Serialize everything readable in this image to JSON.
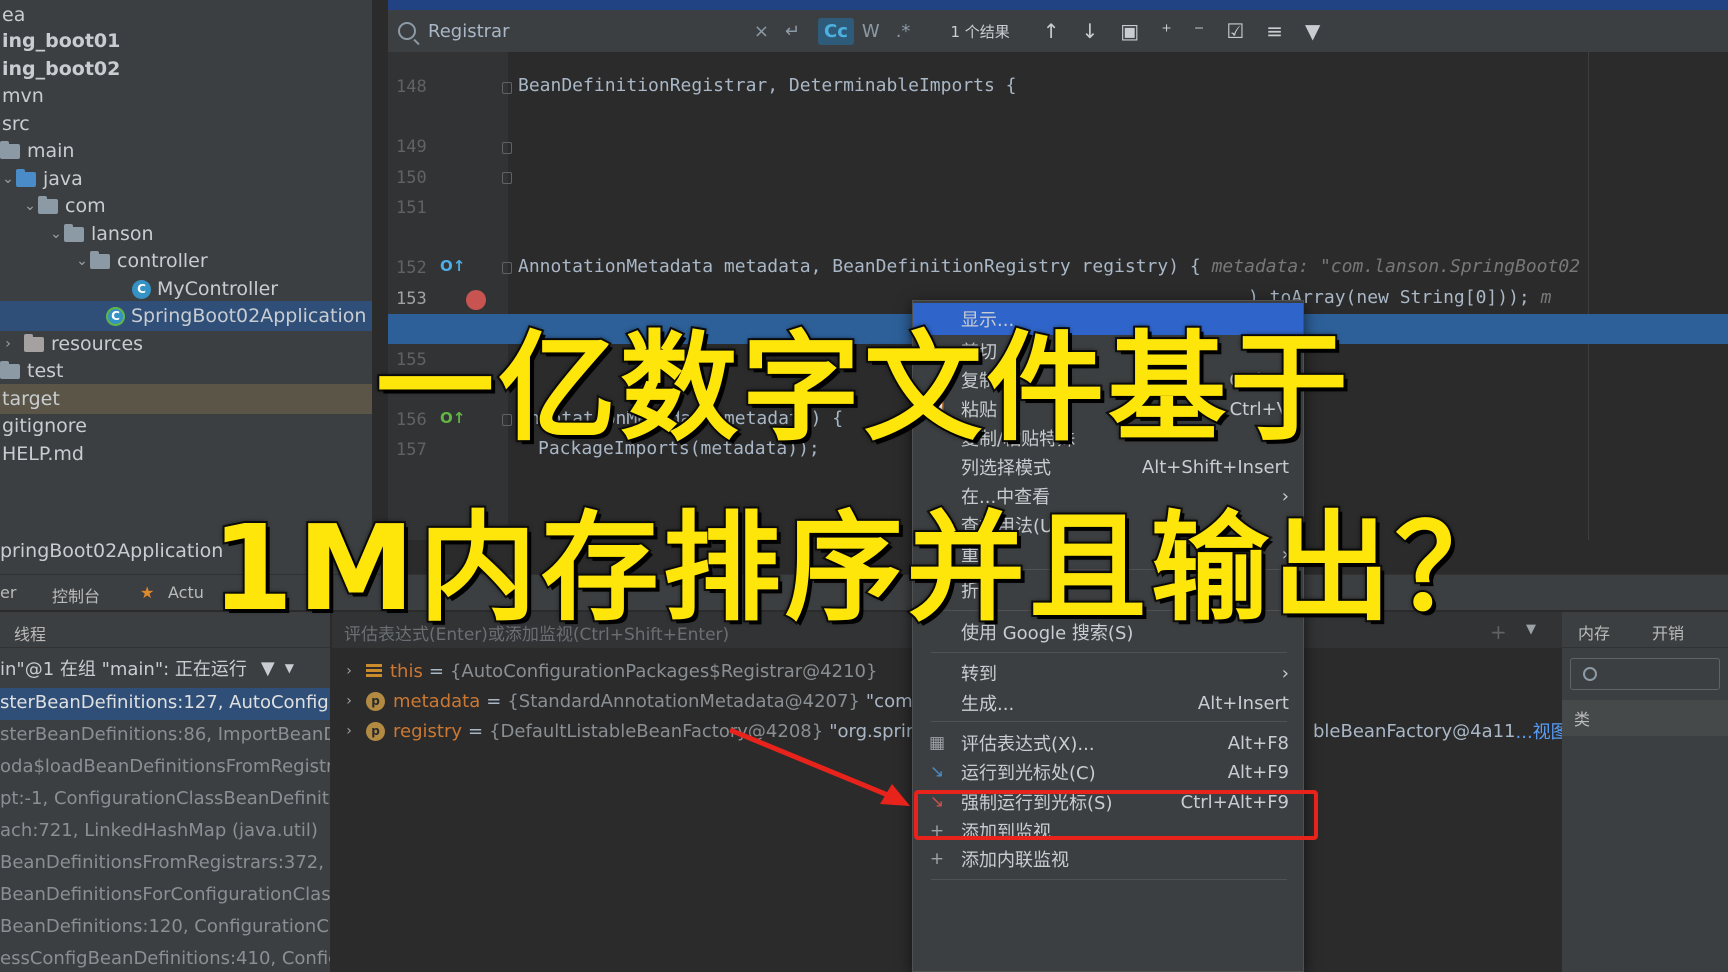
{
  "project_tree": {
    "items": [
      {
        "label": "ea",
        "kind": "folder",
        "expanded": false,
        "bold": false
      },
      {
        "label": "ing_boot01",
        "kind": "module",
        "bold": true
      },
      {
        "label": "ing_boot02",
        "kind": "module",
        "bold": true
      },
      {
        "label": "mvn",
        "kind": "folder"
      },
      {
        "label": "src",
        "kind": "folder"
      },
      {
        "label": "main",
        "kind": "folder"
      },
      {
        "label": "java",
        "kind": "source-folder"
      },
      {
        "label": "com",
        "kind": "package"
      },
      {
        "label": "lanson",
        "kind": "package"
      },
      {
        "label": "controller",
        "kind": "package"
      },
      {
        "label": "MyController",
        "kind": "class"
      },
      {
        "label": "SpringBoot02Application",
        "kind": "app-class",
        "selected": true
      },
      {
        "label": "resources",
        "kind": "resources-folder"
      },
      {
        "label": "test",
        "kind": "folder"
      },
      {
        "label": "target",
        "kind": "folder",
        "highlighted": true
      },
      {
        "label": "gitignore",
        "kind": "file"
      },
      {
        "label": "HELP.md",
        "kind": "file"
      }
    ]
  },
  "search": {
    "query": "Registrar",
    "case_btn": "Cc",
    "word_btn": "W",
    "regex_btn": ".*",
    "result_count": "1 个结果"
  },
  "editor": {
    "lines": [
      {
        "num": "148",
        "text": "BeanDefinitionRegistrar, DeterminableImports {"
      },
      {
        "num": "149",
        "text": ""
      },
      {
        "num": "150",
        "text": ""
      },
      {
        "num": "151",
        "text": ""
      },
      {
        "num": "152",
        "text": "AnnotationMetadata metadata, BeanDefinitionRegistry registry) {",
        "hint": "metadata: \"com.lanson.SpringBoot02"
      },
      {
        "num": "153",
        "text": ").toArray(new String[0]));",
        "hint": "m"
      },
      {
        "num": "155",
        "text": ""
      },
      {
        "num": "156",
        "text": "AnnotationMetadata metadata) {"
      },
      {
        "num": "157",
        "text": "PackageImports(metadata));"
      }
    ]
  },
  "run_config": {
    "title": "pringBoot02Application"
  },
  "tool_tabs": {
    "debugger": "er",
    "console": "控制台",
    "actuator": "Actu"
  },
  "frames": {
    "header": "线程",
    "thread_label": "in\"@1 在组 \"main\": 正在运行",
    "items": [
      "sterBeanDefinitions:127, AutoConfigu",
      "sterBeanDefinitions:86, ImportBeanDe",
      "oda$loadBeanDefinitionsFromRegistra",
      "pt:-1, ConfigurationClassBeanDefinitio",
      "ach:721, LinkedHashMap (java.util)",
      "BeanDefinitionsFromRegistrars:372, C",
      "BeanDefinitionsForConfigurationClass",
      "BeanDefinitions:120, ConfigurationCla",
      "essConfigBeanDefinitions:410, Config"
    ]
  },
  "variables": {
    "eval_placeholder": "评估表达式(Enter)或添加监视(Ctrl+Shift+Enter)",
    "rows": [
      {
        "name": "this",
        "value": "{AutoConfigurationPackages$Registrar@4210}",
        "extra": ""
      },
      {
        "name": "metadata",
        "value": "{StandardAnnotationMetadata@4207}",
        "extra": "\"com.la"
      },
      {
        "name": "registry",
        "value": "{DefaultListableBeanFactory@4208}",
        "extra": "\"org.springf"
      }
    ],
    "right_text": "bleBeanFactory@4a11",
    "view_link": "...视图"
  },
  "side_panel": {
    "memory_tab": "内存",
    "overhead_tab": "开销",
    "column": "类"
  },
  "context_menu": {
    "items": [
      {
        "label": "显示...",
        "shortcut": "",
        "active": true
      },
      {
        "label": "剪切",
        "shortcut": ""
      },
      {
        "label": "复制",
        "shortcut": "Ctrl+C"
      },
      {
        "label": "粘贴",
        "shortcut": "Ctrl+V"
      },
      {
        "label": "复制/粘贴特殊",
        "submenu": true
      },
      {
        "label": "列选择模式",
        "shortcut": "Alt+Shift+Insert"
      },
      {
        "label": "在...中查看",
        "submenu": true
      },
      {
        "label": "查找用法(U)",
        "shortcut": ""
      },
      {
        "label": "重构",
        "submenu": true
      },
      {
        "label": "折叠",
        "submenu": true
      },
      {
        "label": "使用 Google 搜索(S)",
        "shortcut": ""
      },
      {
        "label": "转到",
        "submenu": true
      },
      {
        "label": "生成...",
        "shortcut": "Alt+Insert"
      },
      {
        "label": "评估表达式(X)...",
        "shortcut": "Alt+F8",
        "boxed": true
      },
      {
        "label": "运行到光标处(C)",
        "shortcut": "Alt+F9"
      },
      {
        "label": "强制运行到光标(S)",
        "shortcut": "Ctrl+Alt+F9"
      },
      {
        "label": "添加到监视",
        "shortcut": ""
      },
      {
        "label": "添加内联监视",
        "shortcut": ""
      }
    ]
  },
  "overlay": {
    "line1": "一亿数字文件基于",
    "line2": "1M内存排序并且输出？"
  },
  "colors": {
    "overlay_text": "#ffe60a",
    "highlight_box": "#e8231c",
    "selection": "#2f65ca"
  }
}
